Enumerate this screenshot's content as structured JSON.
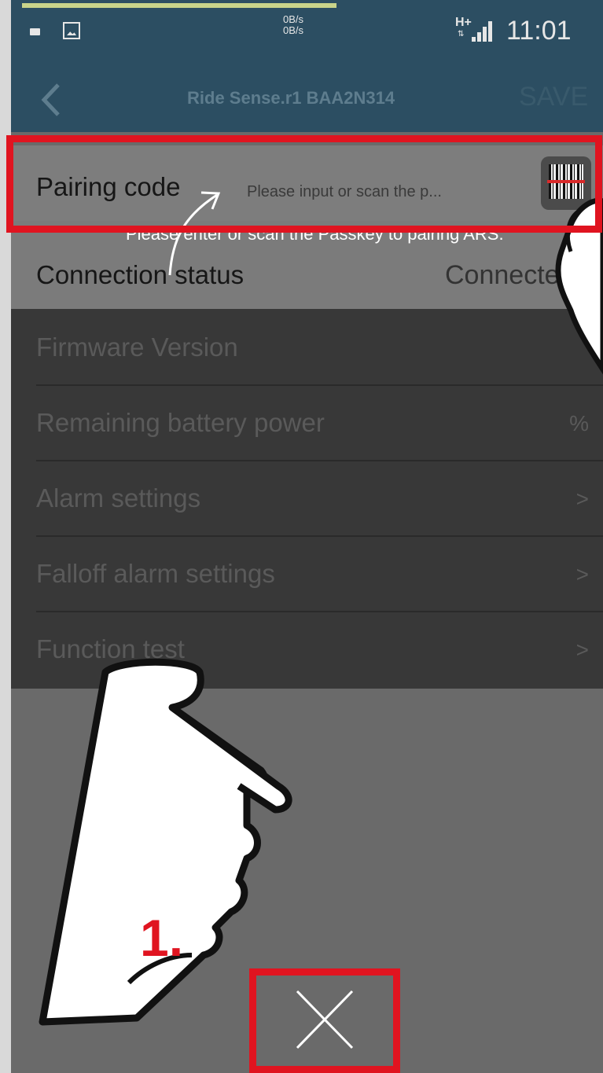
{
  "status_bar": {
    "net_speed_up": "0B/s",
    "net_speed_down": "0B/s",
    "network_type": "H+",
    "time": "11:01"
  },
  "header": {
    "title": "Ride Sense.r1 BAA2N314",
    "save_label": "SAVE"
  },
  "rows": {
    "pairing_code": {
      "label": "Pairing code",
      "placeholder": "Please input or scan the p...",
      "value": ""
    },
    "connection_status": {
      "label": "Connection status",
      "value": "Connected"
    },
    "firmware_version": {
      "label": "Firmware Version",
      "value": ""
    },
    "battery": {
      "label": "Remaining battery power",
      "value": "%"
    },
    "alarm_settings": {
      "label": "Alarm settings",
      "value": ">"
    },
    "falloff_alarm_settings": {
      "label": "Falloff alarm settings",
      "value": ">"
    },
    "function_test": {
      "label": "Function test",
      "value": ">"
    }
  },
  "tutorial": {
    "tooltip": "Please enter or scan the Passkey to pairing ARS.",
    "step": "1.",
    "highlight_color": "#e01420"
  },
  "icons": {
    "back": "chevron-left-icon",
    "barcode": "barcode-scan-icon",
    "close": "close-icon",
    "pointer": "pointing-hand-icon"
  },
  "colors": {
    "header": "#2c4e62",
    "overlay": "#6a6a6a",
    "highlight": "#e01420"
  }
}
